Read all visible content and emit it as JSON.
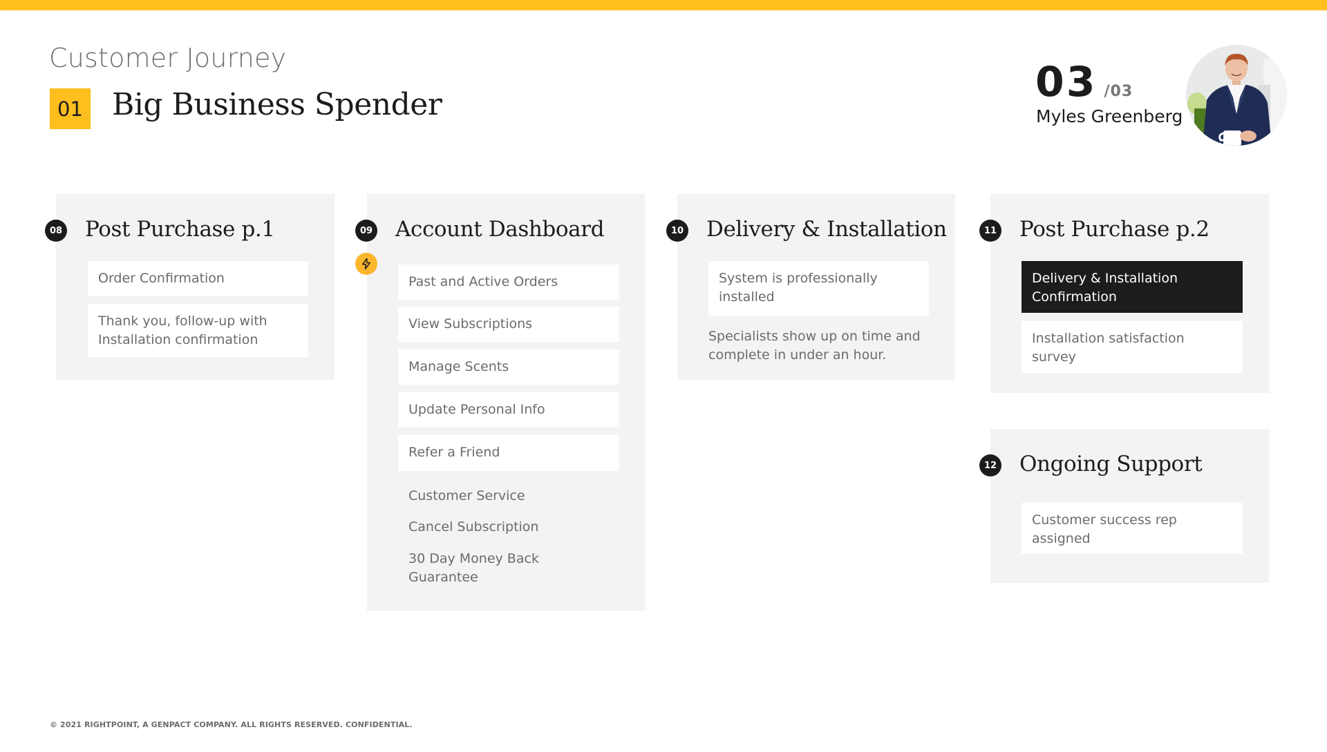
{
  "header": {
    "eyebrow": "Customer Journey",
    "persona_number": "01",
    "persona_title": "Big Business Spender",
    "accent_color": "#FDBE1E"
  },
  "profile": {
    "page_current": "03",
    "page_total": "/03",
    "name": "Myles Greenberg",
    "avatar_icon": "person-photo"
  },
  "cards": [
    {
      "badge": "08",
      "title": "Post Purchase p.1",
      "items": [
        {
          "text": "Order Confirmation"
        },
        {
          "text": "Thank you, follow-up with Installation confirmation"
        }
      ]
    },
    {
      "badge": "09",
      "title": "Account Dashboard",
      "extra_icon": "lightning-bolt-icon",
      "items": [
        {
          "text": "Past and Active Orders"
        },
        {
          "text": "View Subscriptions"
        },
        {
          "text": "Manage Scents"
        },
        {
          "text": "Update Personal Info"
        },
        {
          "text": "Refer a Friend"
        }
      ],
      "plain_items": [
        {
          "text": "Customer Service"
        },
        {
          "text": "Cancel Subscription"
        },
        {
          "text": "30 Day Money Back Guarantee"
        }
      ]
    },
    {
      "badge": "10",
      "title": "Delivery & Installation",
      "items": [
        {
          "text": "System is professionally installed"
        }
      ],
      "note": "Specialists show up on time and complete in under an hour."
    },
    {
      "badge": "11",
      "title": "Post Purchase p.2",
      "items": [
        {
          "text": "Delivery & Installation Confirmation",
          "highlighted": true
        },
        {
          "text": "Installation satisfaction survey"
        }
      ]
    },
    {
      "badge": "12",
      "title": "Ongoing Support",
      "items": [
        {
          "text": "Customer success rep assigned"
        }
      ]
    }
  ],
  "footer": {
    "text": "© 2021 RIGHTPOINT, A GENPACT COMPANY. ALL RIGHTS RESERVED. CONFIDENTIAL."
  }
}
